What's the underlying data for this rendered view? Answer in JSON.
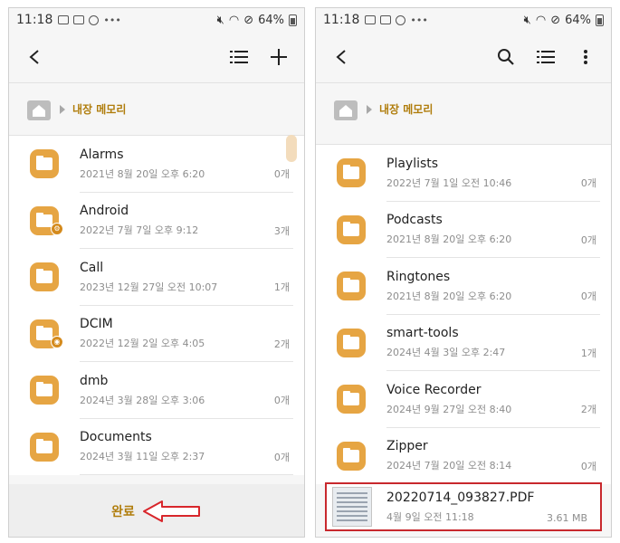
{
  "left": {
    "status": {
      "time": "11:18",
      "battery": "64%"
    },
    "path": {
      "label": "내장 메모리"
    },
    "folders": [
      {
        "name": "Alarms",
        "date": "2021년 8월 20일 오후 6:20",
        "count": "0개",
        "badge": ""
      },
      {
        "name": "Android",
        "date": "2022년 7월 7일 오후 9:12",
        "count": "3개",
        "badge": "⚙"
      },
      {
        "name": "Call",
        "date": "2023년 12월 27일 오전 10:07",
        "count": "1개",
        "badge": ""
      },
      {
        "name": "DCIM",
        "date": "2022년 12월 2일 오후 4:05",
        "count": "2개",
        "badge": "◉"
      },
      {
        "name": "dmb",
        "date": "2024년 3월 28일 오후 3:06",
        "count": "0개",
        "badge": ""
      },
      {
        "name": "Documents",
        "date": "2024년 3월 11일 오후 2:37",
        "count": "0개",
        "badge": ""
      }
    ],
    "done_label": "완료"
  },
  "right": {
    "status": {
      "time": "11:18",
      "battery": "64%"
    },
    "path": {
      "label": "내장 메모리"
    },
    "folders": [
      {
        "name": "Playlists",
        "date": "2022년 7월 1일 오전 10:46",
        "count": "0개"
      },
      {
        "name": "Podcasts",
        "date": "2021년 8월 20일 오후 6:20",
        "count": "0개"
      },
      {
        "name": "Ringtones",
        "date": "2021년 8월 20일 오후 6:20",
        "count": "0개"
      },
      {
        "name": "smart-tools",
        "date": "2024년 4월 3일 오후 2:47",
        "count": "1개"
      },
      {
        "name": "Voice Recorder",
        "date": "2024년 9월 27일 오전 8:40",
        "count": "2개"
      },
      {
        "name": "Zipper",
        "date": "2024년 7월 20일 오전 8:14",
        "count": "0개"
      }
    ],
    "file": {
      "name": "20220714_093827.PDF",
      "date": "4월 9일 오전 11:18",
      "size": "3.61 MB"
    }
  },
  "colors": {
    "accent": "#b07d0c",
    "folder": "#e6a543",
    "highlight": "#c8282d",
    "arrow": "#d8262b"
  }
}
